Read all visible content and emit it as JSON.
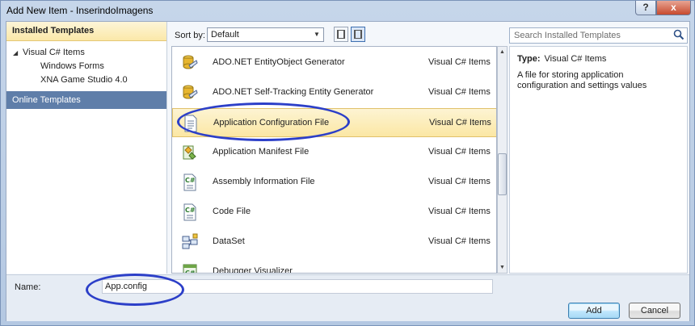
{
  "window": {
    "title": "Add New Item - InserindoImagens",
    "help_glyph": "?",
    "close_glyph": "x"
  },
  "left_pane": {
    "installed_header": "Installed Templates",
    "tree": [
      {
        "label": "Visual C# Items",
        "level": 0,
        "expanded": true
      },
      {
        "label": "Windows Forms",
        "level": 1
      },
      {
        "label": "XNA Game Studio 4.0",
        "level": 1
      }
    ],
    "online_templates": "Online Templates"
  },
  "toolbar": {
    "sort_label": "Sort by:",
    "sort_value": "Default"
  },
  "search": {
    "placeholder": "Search Installed Templates"
  },
  "templates": [
    {
      "name": "ADO.NET EntityObject Generator",
      "category": "Visual C# Items",
      "icon": "entity-generator-icon"
    },
    {
      "name": "ADO.NET Self-Tracking Entity Generator",
      "category": "Visual C# Items",
      "icon": "entity-generator-icon"
    },
    {
      "name": "Application Configuration File",
      "category": "Visual C# Items",
      "icon": "config-file-icon",
      "selected": true
    },
    {
      "name": "Application Manifest File",
      "category": "Visual C# Items",
      "icon": "manifest-file-icon"
    },
    {
      "name": "Assembly Information File",
      "category": "Visual C# Items",
      "icon": "csharp-file-icon"
    },
    {
      "name": "Code File",
      "category": "Visual C# Items",
      "icon": "csharp-file-icon"
    },
    {
      "name": "DataSet",
      "category": "Visual C# Items",
      "icon": "dataset-icon"
    },
    {
      "name": "Debugger Visualizer",
      "category": "",
      "icon": "visualizer-icon"
    }
  ],
  "details": {
    "type_label": "Type:",
    "type_value": "Visual C# Items",
    "description": "A file for storing application configuration and settings values"
  },
  "name_field": {
    "label": "Name:",
    "value": "App.config"
  },
  "buttons": {
    "add": "Add",
    "cancel": "Cancel"
  },
  "colors": {
    "annotation": "#2c3fc8",
    "selected_row": "#fbe7a4",
    "online_templates_bg": "#5f7ea9"
  }
}
